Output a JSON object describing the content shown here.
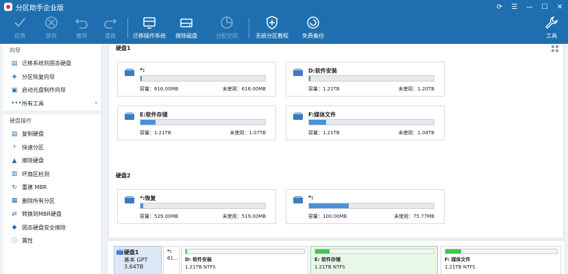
{
  "window": {
    "title": "分区助手企业版"
  },
  "toolbar": {
    "apply": "应用",
    "discard": "放弃",
    "undo": "撤销",
    "redo": "重做",
    "migrate_os": "迁移操作系统",
    "wipe_disk": "擦除磁盘",
    "allocate_space": "分配空间",
    "lossless_partition": "无损分区教程",
    "free_backup": "免费备份",
    "tools": "工具"
  },
  "sidebar": {
    "wizard_title": "向导",
    "wizard_items": [
      {
        "label": "迁移系统到固态硬盘",
        "icon": "migrate-icon"
      },
      {
        "label": "分区恢复向导",
        "icon": "recover-icon"
      },
      {
        "label": "启动光盘制作向导",
        "icon": "bootdisk-icon"
      },
      {
        "label": "所有工具",
        "icon": "more-icon"
      }
    ],
    "disk_ops_title": "硬盘操作",
    "disk_items": [
      {
        "label": "复制硬盘",
        "icon": "copy-disk-icon"
      },
      {
        "label": "快速分区",
        "icon": "lightning-icon"
      },
      {
        "label": "擦除硬盘",
        "icon": "eraser-icon"
      },
      {
        "label": "坏扇区检测",
        "icon": "sector-check-icon"
      },
      {
        "label": "重建 MBR",
        "icon": "rebuild-mbr-icon"
      },
      {
        "label": "删除所有分区",
        "icon": "trash-icon"
      },
      {
        "label": "转换到MBR硬盘",
        "icon": "convert-icon"
      },
      {
        "label": "固态硬盘安全擦除",
        "icon": "ssd-erase-icon"
      },
      {
        "label": "属性",
        "icon": "info-icon"
      }
    ]
  },
  "main": {
    "disk1_label": "硬盘1",
    "disk2_label": "硬盘2",
    "partitions": [
      {
        "name": "*:",
        "capacity": "容量：616.00MB",
        "free": "未使用：616.00MB",
        "used_fraction": 0.0
      },
      {
        "name": "D:软件安装",
        "capacity": "容量：1.21TB",
        "free": "未使用：1.20TB",
        "used_fraction": 0.01
      },
      {
        "name": "E:软件存储",
        "capacity": "容量：1.21TB",
        "free": "未使用：1.07TB",
        "used_fraction": 0.12
      },
      {
        "name": "F:媒体文件",
        "capacity": "容量：1.21TB",
        "free": "未使用：1.04TB",
        "used_fraction": 0.14
      },
      {
        "name": "*:恢复",
        "capacity": "容量：529.00MB",
        "free": "未使用：519.00MB",
        "used_fraction": 0.02
      },
      {
        "name": "*:",
        "capacity": "容量：100.00MB",
        "free": "未使用：75.77MB",
        "used_fraction": 0.32
      }
    ]
  },
  "diskmap": {
    "disk_name": "硬盘1",
    "disk_type": "基本 GPT",
    "disk_size": "3.64TB",
    "parts": [
      {
        "name": "*:",
        "info": "61..."
      },
      {
        "name": "D: 软件安装",
        "info": "1.21TB NTFS",
        "fill": 0.01
      },
      {
        "name": "E: 软件存储",
        "info": "1.21TB NTFS",
        "fill": 0.12
      },
      {
        "name": "F: 媒体文件",
        "info": "1.21TB NTFS",
        "fill": 0.14
      }
    ]
  },
  "colors": {
    "brand": "#1f6fb0",
    "bar": "#4a90d9",
    "map_bar": "#3cc84a"
  }
}
